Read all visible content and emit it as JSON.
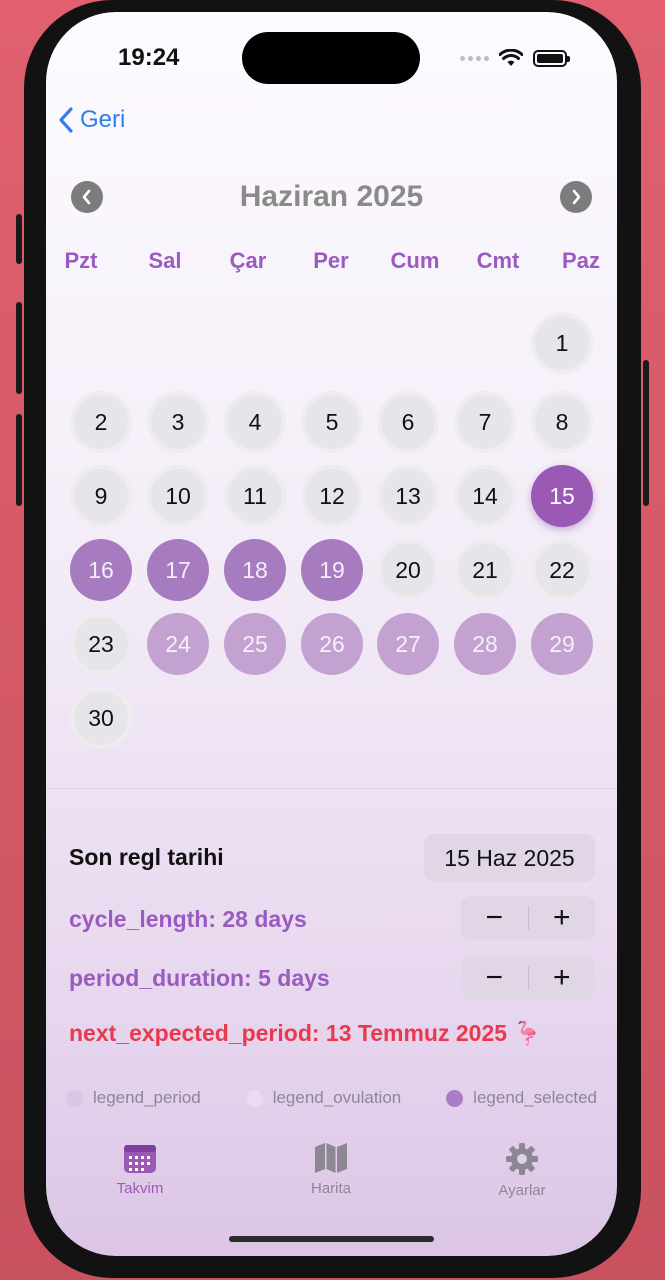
{
  "status_bar": {
    "time": "19:24"
  },
  "nav": {
    "back_label": "Geri"
  },
  "calendar": {
    "month_title": "Haziran 2025",
    "weekdays": [
      "Pzt",
      "Sal",
      "Çar",
      "Per",
      "Cum",
      "Cmt",
      "Paz"
    ],
    "days": [
      "1",
      "2",
      "3",
      "4",
      "5",
      "6",
      "7",
      "8",
      "9",
      "10",
      "11",
      "12",
      "13",
      "14",
      "15",
      "16",
      "17",
      "18",
      "19",
      "20",
      "21",
      "22",
      "23",
      "24",
      "25",
      "26",
      "27",
      "28",
      "29",
      "30"
    ]
  },
  "form": {
    "last_period_label": "Son regl tarihi",
    "last_period_value": "15 Haz 2025",
    "cycle_length_label": "cycle_length: 28 days",
    "period_duration_label": "period_duration: 5 days",
    "minus": "−",
    "plus": "+",
    "next_expected_label": "next_expected_period: 13 Temmuz 2025 🦩"
  },
  "legend": {
    "period": "legend_period",
    "ovulation": "legend_ovulation",
    "selected": "legend_selected"
  },
  "tabs": {
    "calendar": "Takvim",
    "map": "Harita",
    "settings": "Ayarlar"
  },
  "colors": {
    "accent": "#9b59b6",
    "period": "#a77bbf",
    "ovulation": "#c3a2d2",
    "alert": "#e8394f",
    "link": "#2f80ed"
  }
}
